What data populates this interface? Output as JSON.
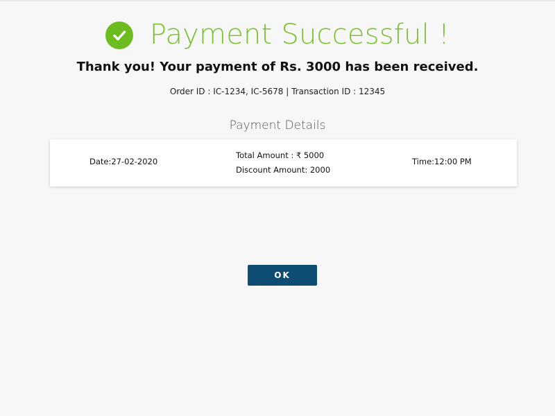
{
  "header": {
    "title": "Payment Successful !",
    "icon": "check-circle-icon",
    "accent_color": "#7cc133"
  },
  "message": {
    "thanks": "Thank you! Your payment of Rs. 3000 has been received.",
    "ids": "Order ID : IC-1234, IC-5678 | Transaction ID : 12345"
  },
  "details": {
    "heading": "Payment Details",
    "date": "Date:27-02-2020",
    "total_amount": "Total Amount : ₹ 5000",
    "discount_amount": "Discount Amount: 2000",
    "time": "Time:12:00 PM"
  },
  "actions": {
    "ok_label": "OK",
    "ok_color": "#0d4c73"
  }
}
